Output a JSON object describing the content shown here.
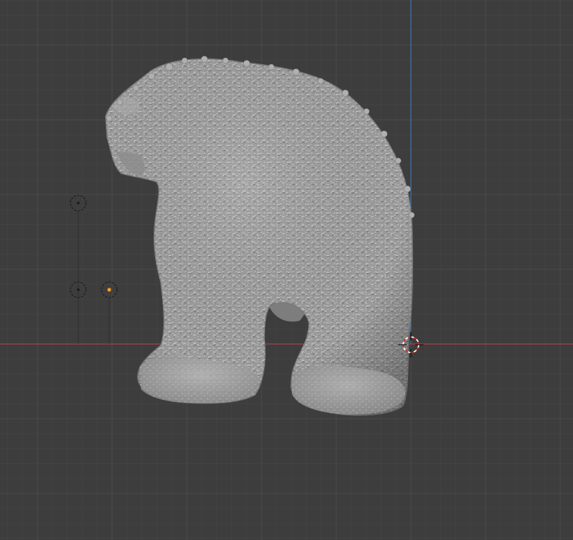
{
  "viewport": {
    "view": "front-orthographic",
    "background_color": "#3d3d3d",
    "grid_minor_color": "#444444",
    "grid_major_color": "#4a4a4a",
    "x_axis_color": "#a8404a",
    "z_axis_color": "#3e6fa8",
    "mesh_color": "#9a9a9a",
    "mesh_shadow_color": "#6e6e6e",
    "mesh_highlight_color": "#bdbdbd",
    "selected_object_origin_color": "#ff9e2a"
  },
  "scene": {
    "mesh_object": "bear-sculpt-mesh",
    "empties": [
      "empty-object",
      "empty-object",
      "empty-object"
    ],
    "cursor": "3d-cursor"
  }
}
